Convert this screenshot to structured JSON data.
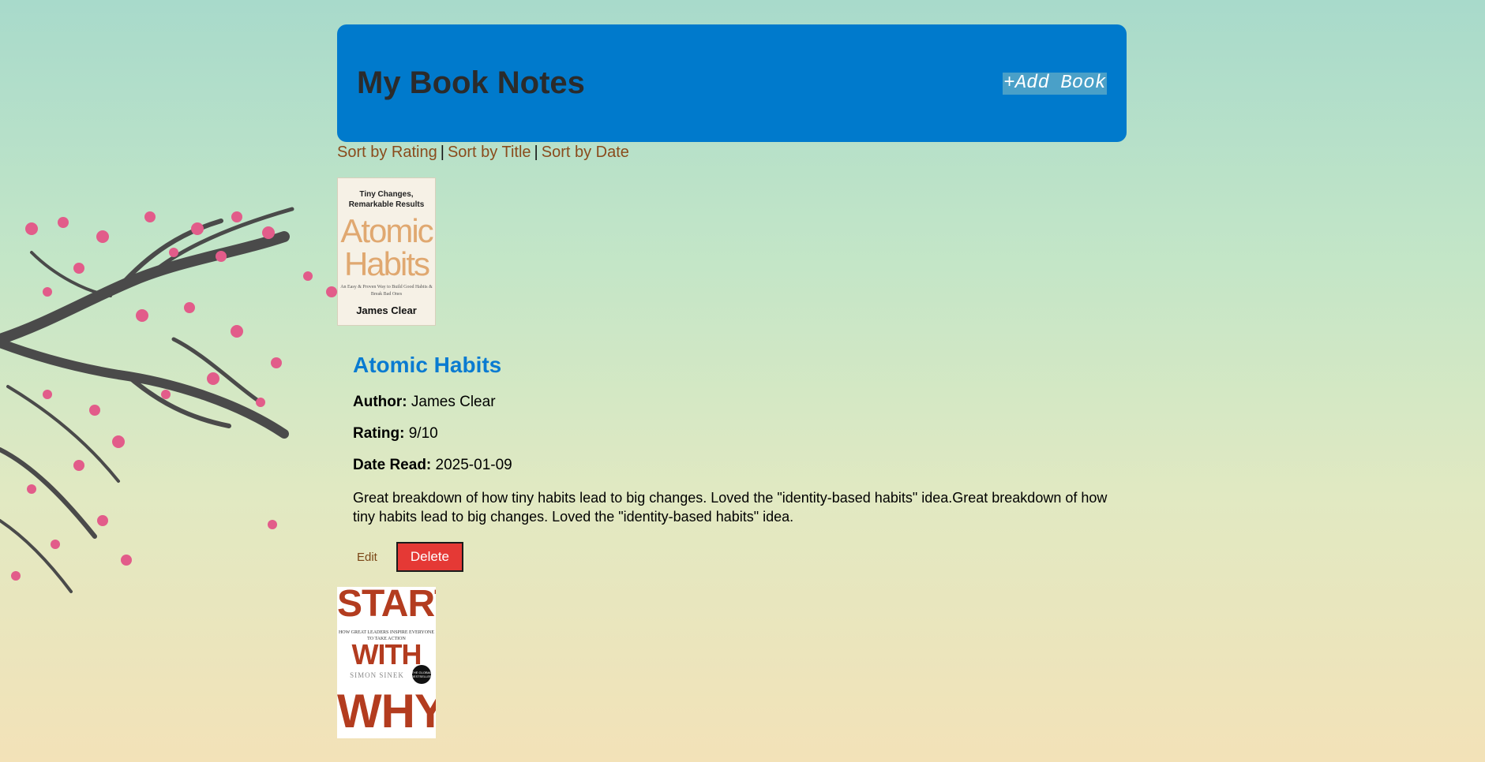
{
  "header": {
    "title": "My Book Notes",
    "add_button": "+Add Book"
  },
  "sort": {
    "rating": "Sort by Rating",
    "separator": "|",
    "title": "Sort by Title",
    "date": "Sort by Date"
  },
  "books": [
    {
      "cover": {
        "tagline": "Tiny Changes, Remarkable Results",
        "title": "Atomic Habits",
        "subtitle": "An Easy & Proven Way to Build Good Habits & Break Bad Ones",
        "author": "James Clear"
      },
      "title": "Atomic Habits",
      "author_label": "Author:",
      "author": "James Clear",
      "rating_label": "Rating:",
      "rating": "9/10",
      "date_label": "Date Read:",
      "date": "2025-01-09",
      "notes": "Great breakdown of how tiny habits lead to big changes. Loved the \"identity-based habits\" idea.Great breakdown of how tiny habits lead to big changes. Loved the \"identity-based habits\" idea.",
      "edit_label": "Edit",
      "delete_label": "Delete"
    },
    {
      "cover": {
        "line1": "START",
        "tagline": "HOW GREAT LEADERS INSPIRE EVERYONE TO TAKE ACTION",
        "line2": "WITH",
        "author": "SIMON SINEK",
        "badge": "THE GLOBAL BESTSELLER",
        "line3": "WHY"
      }
    }
  ],
  "colors": {
    "header_bg": "#007acc",
    "title_blue": "#0a7bd1",
    "sort_link": "#8a4b1c",
    "delete_bg": "#e53935"
  }
}
